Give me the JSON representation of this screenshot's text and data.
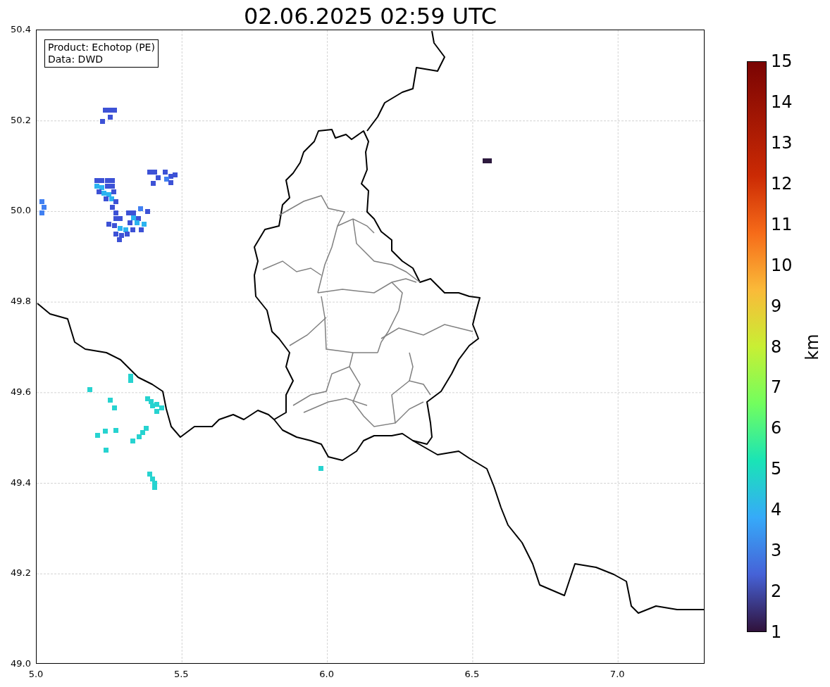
{
  "title": "02.06.2025 02:59 UTC",
  "map": {
    "info_box": [
      "Product: Echotop (PE)",
      "Data: DWD"
    ],
    "x_ticks": [
      "5.0",
      "5.5",
      "6.0",
      "6.5",
      "7.0"
    ],
    "y_ticks": [
      "50.4",
      "50.2",
      "50.0",
      "49.8",
      "49.6",
      "49.4",
      "49.2",
      "49.0"
    ]
  },
  "colorbar": {
    "label": "km",
    "ticks": [
      "15",
      "14",
      "13",
      "12",
      "11",
      "10",
      "9",
      "8",
      "7",
      "6",
      "5",
      "4",
      "3",
      "2",
      "1"
    ]
  }
}
